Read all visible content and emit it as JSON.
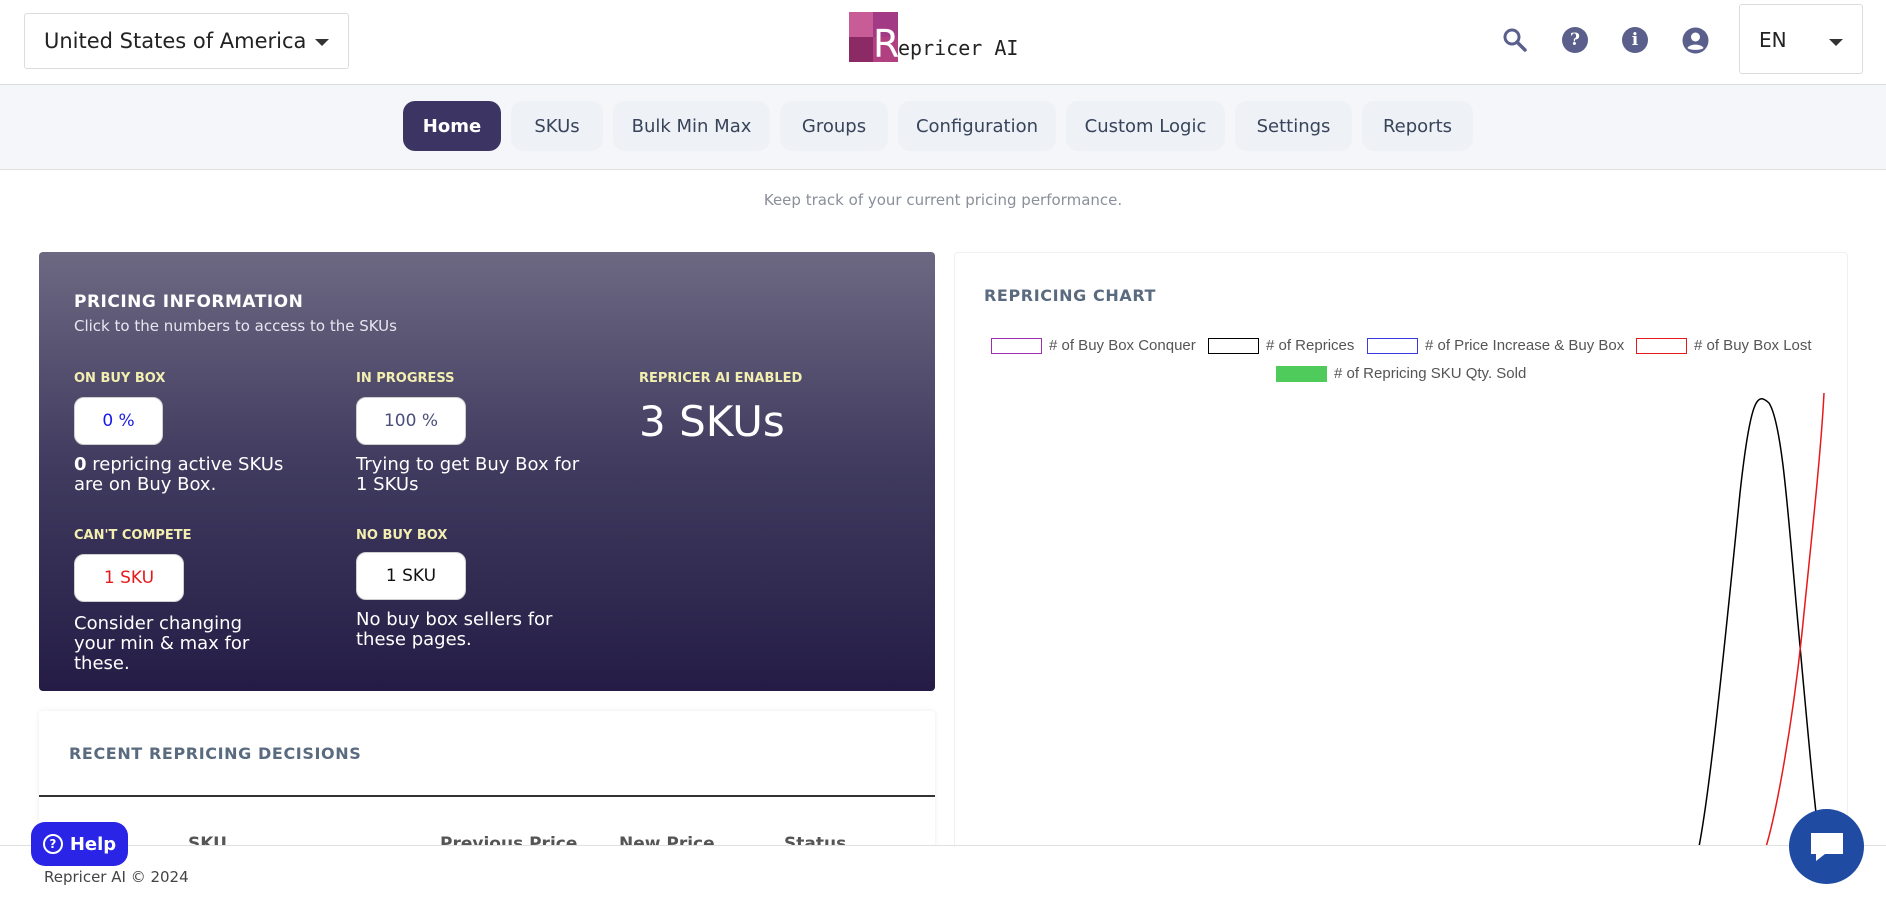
{
  "header": {
    "country": "United States of America",
    "logo_letter": "R",
    "logo_text": "epricer AI",
    "language": "EN",
    "icons": [
      "search-icon",
      "help-circle-icon",
      "info-icon",
      "account-icon"
    ]
  },
  "nav": {
    "tabs": [
      {
        "label": "Home",
        "active": true
      },
      {
        "label": "SKUs"
      },
      {
        "label": "Bulk Min Max"
      },
      {
        "label": "Groups"
      },
      {
        "label": "Configuration"
      },
      {
        "label": "Custom Logic"
      },
      {
        "label": "Settings"
      },
      {
        "label": "Reports"
      }
    ]
  },
  "subtitle": "Keep track of your current pricing performance.",
  "pricing": {
    "title": "PRICING INFORMATION",
    "subtitle": "Click to the numbers to access to the SKUs",
    "on_buy_box": {
      "label": "ON BUY BOX",
      "value": "0 %",
      "desc_count": "0",
      "desc_rest": " repricing active SKUs are on Buy Box."
    },
    "in_progress": {
      "label": "IN PROGRESS",
      "value": "100 %",
      "desc": "Trying to get Buy Box for 1 SKUs"
    },
    "enabled": {
      "label": "REPRICER AI ENABLED",
      "value": "3 SKUs"
    },
    "cant_compete": {
      "label": "CAN'T COMPETE",
      "value": "1 SKU",
      "desc": "Consider changing your min & max for these."
    },
    "no_buy_box": {
      "label": "NO BUY BOX",
      "value": "1 SKU",
      "desc": "No buy box sellers for these pages."
    },
    "colors": {
      "on_buy_box": "#1a1ae6",
      "in_progress": "#4a4f7a",
      "cant_compete": "#e61a1a",
      "no_buy_box": "#111111"
    }
  },
  "recent": {
    "title": "RECENT REPRICING DECISIONS",
    "columns": [
      "SKU",
      "Previous Price",
      "New Price",
      "Status"
    ]
  },
  "chart": {
    "title": "REPRICING CHART",
    "legend": [
      {
        "name": "# of Buy Box Conquer",
        "color": "#9b2fae",
        "fill": "none"
      },
      {
        "name": "# of Reprices",
        "color": "#000000",
        "fill": "none"
      },
      {
        "name": "# of Price Increase & Buy Box",
        "color": "#3a3ae6",
        "fill": "none"
      },
      {
        "name": "# of Buy Box Lost",
        "color": "#e61a1a",
        "fill": "none"
      },
      {
        "name": "# of Repricing SKU Qty. Sold",
        "color": "#4ecb5a",
        "fill": "#4ecb5a"
      }
    ]
  },
  "chart_data": {
    "type": "line",
    "title": "REPRICING CHART",
    "series": [
      {
        "name": "# of Buy Box Conquer",
        "values": []
      },
      {
        "name": "# of Reprices",
        "values": []
      },
      {
        "name": "# of Price Increase & Buy Box",
        "values": []
      },
      {
        "name": "# of Buy Box Lost",
        "values": []
      },
      {
        "name": "# of Repricing SKU Qty. Sold",
        "values": []
      }
    ],
    "legend": "top"
  },
  "footer": {
    "copyright": "Repricer AI © 2024",
    "help_label": "Help"
  }
}
